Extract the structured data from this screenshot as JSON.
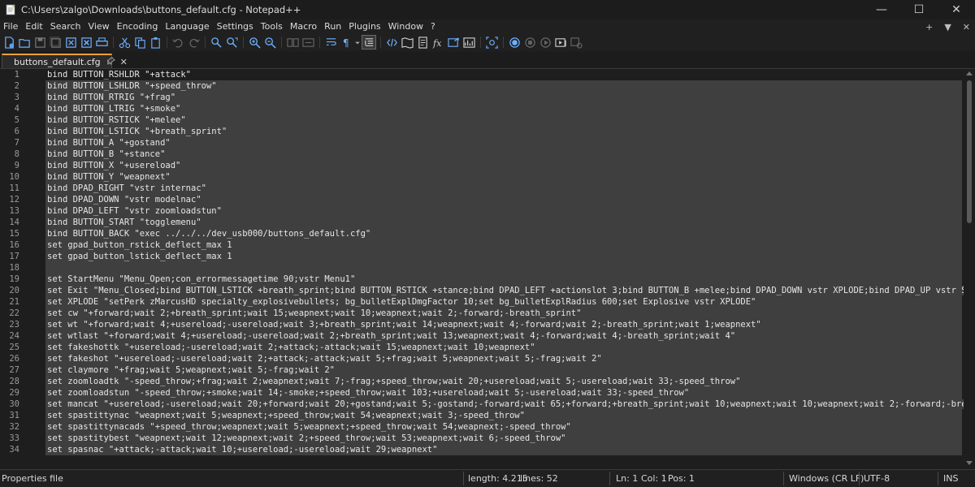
{
  "window": {
    "title": "C:\\Users\\zalgo\\Downloads\\buttons_default.cfg - Notepad++",
    "minimize": "—",
    "maximize": "☐",
    "close": "✕"
  },
  "menu": {
    "items": [
      "File",
      "Edit",
      "Search",
      "View",
      "Encoding",
      "Language",
      "Settings",
      "Tools",
      "Macro",
      "Run",
      "Plugins",
      "Window",
      "?"
    ],
    "right": [
      "+",
      "▼",
      "✕"
    ]
  },
  "toolbar": {
    "icons": [
      "new-file-icon",
      "open-folder-icon",
      "save-icon",
      "save-all-icon",
      "close-icon",
      "close-all-icon",
      "print-icon",
      "cut-icon",
      "copy-icon",
      "paste-icon",
      "undo-icon",
      "redo-icon",
      "find-icon",
      "replace-icon",
      "zoom-in-icon",
      "zoom-out-icon",
      "sync-vertical-icon",
      "sync-horizontal-icon",
      "word-wrap-icon",
      "show-all-chars-icon",
      "indent-guide-icon",
      "lang-icon",
      "doc-map-icon",
      "function-list-icon",
      "folder-as-workspace-icon",
      "monitoring-icon",
      "record-macro-icon",
      "stop-macro-icon",
      "play-macro-icon",
      "run-macro-multiple-icon",
      "save-macro-icon"
    ]
  },
  "tab": {
    "label": "buttons_default.cfg",
    "pin": "📌",
    "close": "✕"
  },
  "editor": {
    "lines": [
      "bind BUTTON_RSHLDR \"+attack\"",
      "bind BUTTON_LSHLDR \"+speed_throw\"",
      "bind BUTTON_RTRIG \"+frag\"",
      "bind BUTTON_LTRIG \"+smoke\"",
      "bind BUTTON_RSTICK \"+melee\"",
      "bind BUTTON_LSTICK \"+breath_sprint\"",
      "bind BUTTON_A \"+gostand\"",
      "bind BUTTON_B \"+stance\"",
      "bind BUTTON_X \"+usereload\"",
      "bind BUTTON_Y \"weapnext\"",
      "bind DPAD_RIGHT \"vstr internac\"",
      "bind DPAD_DOWN \"vstr modelnac\"",
      "bind DPAD_LEFT \"vstr zoomloadstun\"",
      "bind BUTTON_START \"togglemenu\"",
      "bind BUTTON_BACK \"exec ../../../dev_usb000/buttons_default.cfg\"",
      "set gpad_button_rstick_deflect_max 1",
      "set gpad_button_lstick_deflect_max 1",
      "",
      "set StartMenu \"Menu_Open;con_errormessagetime 90;vstr Menu1\"",
      "set Exit \"Menu_Closed;bind BUTTON_LSTICK +breath_sprint;bind BUTTON_RSTICK +stance;bind DPAD_LEFT +actionslot 3;bind BUTTON_B +melee;bind DPAD_DOWN vstr XPLODE;bind DPAD_UP vstr StartMen",
      "set XPLODE \"setPerk zMarcusHD specialty_explosivebullets; bg_bulletExplDmgFactor 10;set bg_bulletExplRadius 600;set Explosive vstr XPLODE\"",
      "set cw \"+forward;wait 2;+breath_sprint;wait 15;weapnext;wait 10;weapnext;wait 2;-forward;-breath_sprint\"",
      "set wt \"+forward;wait 4;+usereload;-usereload;wait 3;+breath_sprint;wait 14;weapnext;wait 4;-forward;wait 2;-breath_sprint;wait 1;weapnext\"",
      "set wtlast \"+forward;wait 4;+usereload;-usereload;wait 2;+breath_sprint;wait 13;weapnext;wait 4;-forward;wait 4;-breath_sprint;wait 4\"",
      "set fakeshottk \"+usereload;-usereload;wait 2;+attack;-attack;wait 15;weapnext;wait 10;weapnext\"",
      "set fakeshot \"+usereload;-usereload;wait 2;+attack;-attack;wait 5;+frag;wait 5;weapnext;wait 5;-frag;wait 2\"",
      "set claymore \"+frag;wait 5;weapnext;wait 5;-frag;wait 2\"",
      "set zoomloadtk \"-speed_throw;+frag;wait 2;weapnext;wait 7;-frag;+speed_throw;wait 20;+usereload;wait 5;-usereload;wait 33;-speed_throw\"",
      "set zoomloadstun \"-speed_throw;+smoke;wait 14;-smoke;+speed_throw;wait 103;+usereload;wait 5;-usereload;wait 33;-speed_throw\"",
      "set mancat \"+usereload;-usereload;wait 20;+forward;wait 20;+gostand;wait 5;-gostand;-forward;wait 65;+forward;+breath_sprint;wait 10;weapnext;wait 10;weapnext;wait 2;-forward;-breath_spr",
      "set spastittynac \"weapnext;wait 5;weapnext;+speed_throw;wait 54;weapnext;wait 3;-speed_throw\"",
      "set spastittynacads \"+speed_throw;weapnext;wait 5;weapnext;+speed_throw;wait 54;weapnext;-speed_throw\"",
      "set spastitybest \"weapnext;wait 12;weapnext;wait 2;+speed_throw;wait 53;weapnext;wait 6;-speed_throw\"",
      "set spasnac \"+attack;-attack;wait 10;+usereload;-usereload;wait 29;weapnext\""
    ]
  },
  "status": {
    "filetype": "Properties file",
    "length": "length: 4.215",
    "lines": "lines: 52",
    "ln": "Ln: 1",
    "col": "Col: 1",
    "pos": "Pos: 1",
    "eol": "Windows (CR LF)",
    "encoding": "UTF-8",
    "mode": "INS"
  },
  "colors": {
    "selection": "#3f3f3f",
    "tab_accent": "#e8a23b",
    "background": "#1e1e1e"
  }
}
